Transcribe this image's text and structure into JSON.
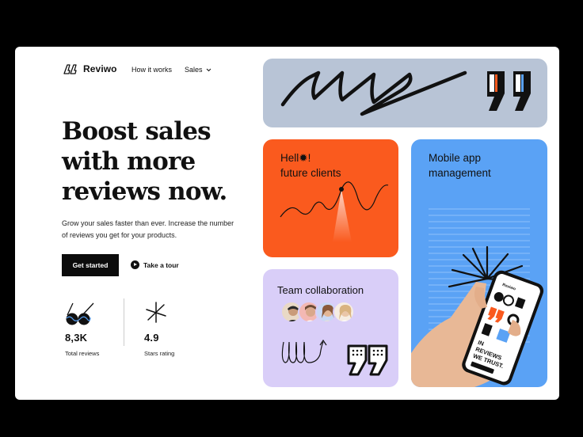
{
  "brand": {
    "name": "Reviwo",
    "logo_icon": "quote-mark-icon"
  },
  "nav": {
    "items": [
      {
        "label": "How it works"
      },
      {
        "label": "Sales",
        "icon": "chevron-down-icon"
      }
    ]
  },
  "hero": {
    "headline_lines": [
      "Boost sales",
      "with more",
      "reviews now."
    ],
    "lead": "Grow your sales faster than ever. Increase the number of reviews you get for your products.",
    "cta_label": "Get started",
    "tour_label": "Take a tour"
  },
  "stats": [
    {
      "value": "8,3K",
      "label": "Total reviews",
      "icon": "glasses-icon"
    },
    {
      "value": "4.9",
      "label": "Stars rating",
      "icon": "asterisk-icon"
    }
  ],
  "cards": {
    "orange": {
      "line1": "Hell✹!",
      "line2": "future clients"
    },
    "purple": {
      "title": "Team collaboration"
    },
    "blue": {
      "line1": "Mobile app",
      "line2": "management"
    }
  },
  "phone": {
    "app_name": "Reviwo",
    "tagline_lines": [
      "IN",
      "REVIEWS",
      "WE TRUST."
    ]
  },
  "colors": {
    "quote_card": "#b8c4d6",
    "orange_card": "#fa5a1e",
    "purple_card": "#d9cef8",
    "blue_card": "#5aa2f5",
    "cta": "#0c0c0c"
  }
}
